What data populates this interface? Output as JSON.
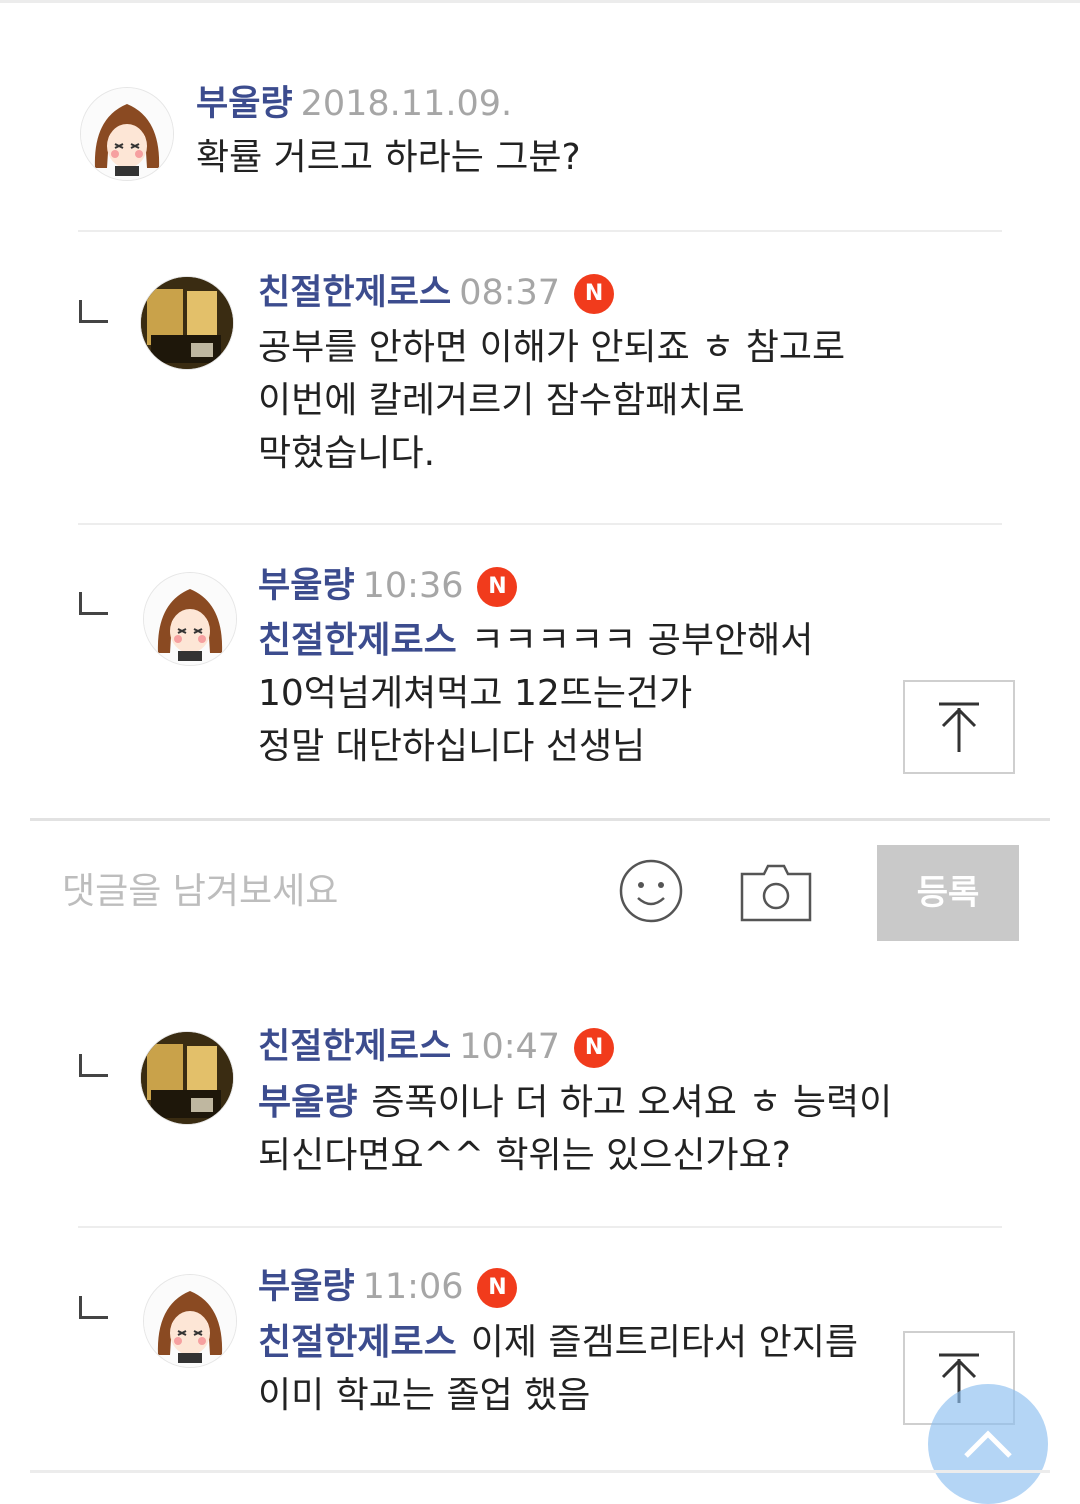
{
  "comments": [
    {
      "author": "부울량",
      "time": "2018.11.09.",
      "is_new": false,
      "mention": "",
      "lines": [
        "확률 거르고 하라는 그분?"
      ]
    },
    {
      "author": "친절한제로스",
      "time": "08:37",
      "is_new": true,
      "badge": "N",
      "mention": "",
      "lines": [
        "공부를 안하면 이해가 안되죠 ㅎ 참고로",
        "이번에 칼레거르기 잠수함패치로",
        "막혔습니다."
      ]
    },
    {
      "author": "부울량",
      "time": "10:36",
      "is_new": true,
      "badge": "N",
      "mention": "친절한제로스",
      "lines": [
        "ㅋㅋㅋㅋㅋ 공부안해서",
        "10억넘게쳐먹고 12뜨는건가",
        "정말 대단하십니다 선생님"
      ]
    },
    {
      "author": "친절한제로스",
      "time": "10:47",
      "is_new": true,
      "badge": "N",
      "mention": "부울량",
      "lines": [
        "증폭이나 더 하고 오셔요 ㅎ 능력이",
        "되신다면요^^ 학위는 있으신가요?"
      ]
    },
    {
      "author": "부울량",
      "time": "11:06",
      "is_new": true,
      "badge": "N",
      "mention": "친절한제로스",
      "lines": [
        "이제 즐겜트리타서 안지름",
        "이미 학교는 졸업 했음"
      ]
    }
  ],
  "comment_input": {
    "placeholder": "댓글을 남겨보세요",
    "submit_label": "등록"
  },
  "icons": {
    "emoji": "smiley-icon",
    "camera": "camera-icon",
    "top": "arrow-up-to-top-icon",
    "scroll": "chevron-up-icon"
  },
  "colors": {
    "author": "#3c4c8e",
    "time": "#a6a6a6",
    "badge": "#f13b1c",
    "submit_bg": "#c9c9c9"
  }
}
